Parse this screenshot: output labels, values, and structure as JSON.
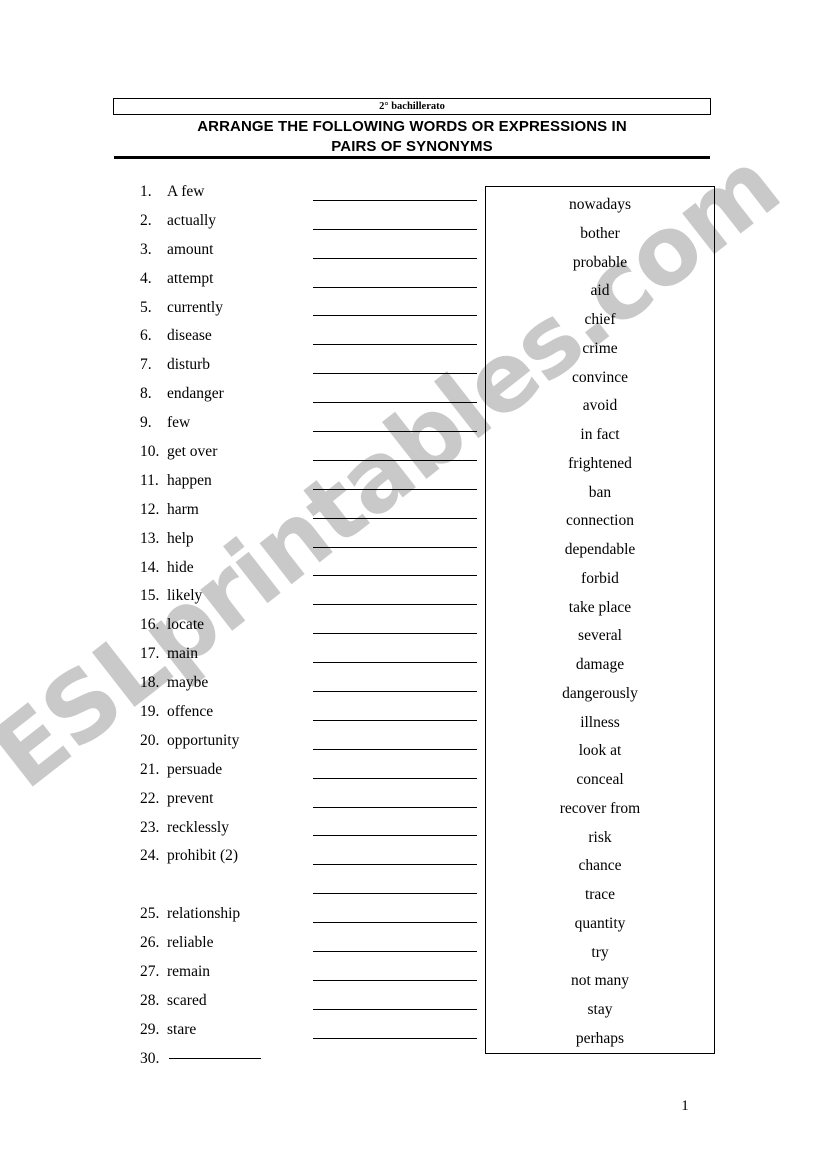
{
  "header": {
    "level": "2° bachillerato",
    "title_line1": "ARRANGE THE FOLLOWING WORDS OR EXPRESSIONS IN",
    "title_line2": "PAIRS OF SYNONYMS"
  },
  "watermark": {
    "text": "ESLprintables.com",
    "color": "#c9c9c9"
  },
  "word_list": [
    {
      "num": "1.",
      "term": "A few"
    },
    {
      "num": "2.",
      "term": "actually"
    },
    {
      "num": "3.",
      "term": "amount"
    },
    {
      "num": "4.",
      "term": "attempt"
    },
    {
      "num": "5.",
      "term": "currently"
    },
    {
      "num": "6.",
      "term": "disease"
    },
    {
      "num": "7.",
      "term": "disturb"
    },
    {
      "num": "8.",
      "term": "endanger"
    },
    {
      "num": "9.",
      "term": "few"
    },
    {
      "num": "10.",
      "term": "get over"
    },
    {
      "num": "11.",
      "term": "happen"
    },
    {
      "num": "12.",
      "term": "harm"
    },
    {
      "num": "13.",
      "term": "help"
    },
    {
      "num": "14.",
      "term": "hide"
    },
    {
      "num": "15.",
      "term": "likely"
    },
    {
      "num": "16.",
      "term": "locate"
    },
    {
      "num": "17.",
      "term": "main"
    },
    {
      "num": "18.",
      "term": "maybe"
    },
    {
      "num": "19.",
      "term": "offence"
    },
    {
      "num": "20.",
      "term": "opportunity"
    },
    {
      "num": "21.",
      "term": "persuade"
    },
    {
      "num": "22.",
      "term": "prevent"
    },
    {
      "num": "23.",
      "term": "recklessly"
    },
    {
      "num": "24.",
      "term": "prohibit (2)"
    },
    {
      "num": "",
      "term": "",
      "spacer": true
    },
    {
      "num": "25.",
      "term": "relationship"
    },
    {
      "num": "26.",
      "term": "reliable"
    },
    {
      "num": "27.",
      "term": "remain"
    },
    {
      "num": "28.",
      "term": "scared"
    },
    {
      "num": "29.",
      "term": "stare"
    },
    {
      "num": "30.",
      "term": "",
      "blank_rule": true
    }
  ],
  "answer_lines_count": 30,
  "word_bank": [
    "nowadays",
    "bother",
    "probable",
    "aid",
    "chief",
    "crime",
    "convince",
    "avoid",
    "in fact",
    "frightened",
    "ban",
    "connection",
    "dependable",
    "forbid",
    "take place",
    "several",
    "damage",
    "dangerously",
    "illness",
    "look at",
    "conceal",
    "recover from",
    "risk",
    "chance",
    "trace",
    "quantity",
    "try",
    "not many",
    "stay",
    "perhaps"
  ],
  "page_number": "1"
}
